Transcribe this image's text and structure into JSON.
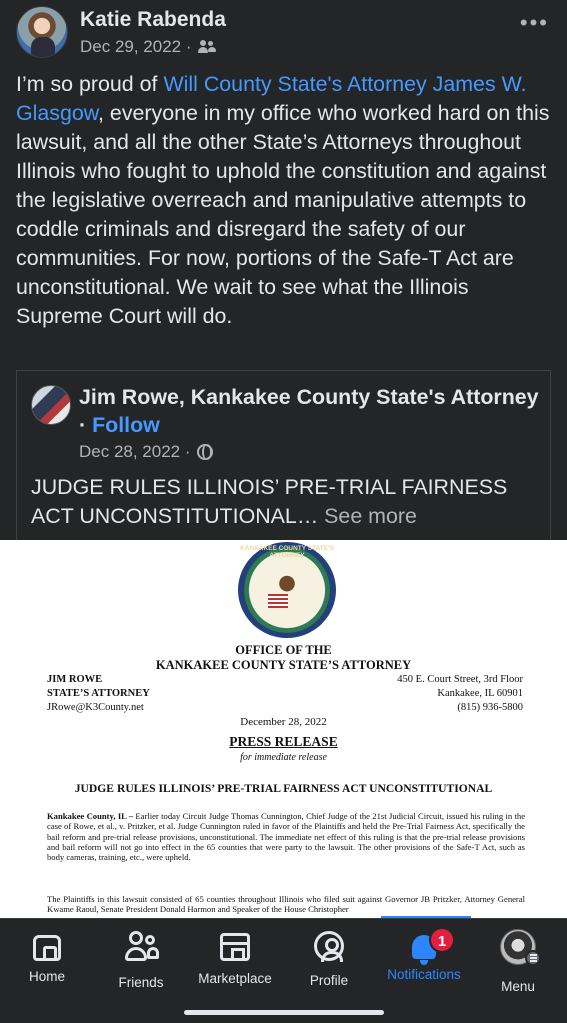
{
  "post": {
    "author": "Katie Rabenda",
    "date": "Dec 29, 2022 ·",
    "text_prefix": "I’m so proud of ",
    "link_text": "Will County State's Attorney James W. Glasgow",
    "text_suffix": ", everyone in my office who worked hard on this lawsuit, and all the other State’s Attorneys throughout Illinois who fought to uphold the constitution and against the legislative overreach and manipulative attempts to coddle criminals and disregard the safety of our communities. For now, portions of the Safe-T Act are unconstitutional. We wait to see what the Illinois Supreme Court will do.",
    "more_label": "•••"
  },
  "shared": {
    "author": "Jim Rowe, Kankakee County State's Attorney",
    "separator": " · ",
    "follow_label": "Follow",
    "date": "Dec 28, 2022 ·",
    "text": "JUDGE RULES ILLINOIS’ PRE-TRIAL FAIRNESS ACT UNCONSTITUTIONAL…",
    "see_more": " See more"
  },
  "document": {
    "seal_text": "KANKAKEE COUNTY STATE'S ATTORNEY",
    "office_line1": "OFFICE OF THE",
    "office_line2": "KANKAKEE COUNTY STATE’S ATTORNEY",
    "name": "JIM ROWE",
    "title": "STATE’S ATTORNEY",
    "email": "JRowe@K3County.net",
    "address1": "450 E. Court Street, 3rd Floor",
    "address2": "Kankakee, IL 60901",
    "phone": "(815) 936-5800",
    "date": "December 28, 2022",
    "press_release": "PRESS RELEASE",
    "immediate": "for immediate release",
    "headline": "JUDGE RULES ILLINOIS’ PRE-TRIAL FAIRNESS ACT UNCONSTITUTIONAL",
    "para1_lead": "Kankakee County, IL –",
    "para1": " Earlier today Circuit Judge Thomas Cunnington, Chief Judge of the 21st Judicial Circuit, issued his ruling in the case of Rowe, et al., v. Pritzker, et al. Judge Cunnington ruled in favor of the Plaintiffs and held the Pre-Trial Fairness Act, specifically the bail reform and pre-trial release provisions, unconstitutional. The immediate net effect of this ruling is that the pre-trial release provisions and bail reform will not go into effect in the 65 counties that were party to the lawsuit. The other provisions of the Safe-T Act, such as body cameras, training, etc., were upheld.",
    "para2": "The Plaintiffs in this lawsuit consisted of 65 counties throughout Illinois who filed suit against Governor JB Pritzker, Attorney General Kwame Raoul, Senate President Donald Harmon and Speaker of the House Christopher"
  },
  "nav": {
    "items": [
      {
        "label": "Home",
        "icon": "home-icon"
      },
      {
        "label": "Friends",
        "icon": "friends-icon"
      },
      {
        "label": "Marketplace",
        "icon": "marketplace-icon"
      },
      {
        "label": "Profile",
        "icon": "profile-icon"
      },
      {
        "label": "Notifications",
        "icon": "bell-icon",
        "badge": "1",
        "active": true
      },
      {
        "label": "Menu",
        "icon": "menu-avatar"
      }
    ]
  },
  "colors": {
    "background": "#242526",
    "text": "#e4e6eb",
    "secondary_text": "#b0b3b8",
    "link": "#4599ff",
    "active": "#2d86ff",
    "badge": "#e41e3f"
  }
}
